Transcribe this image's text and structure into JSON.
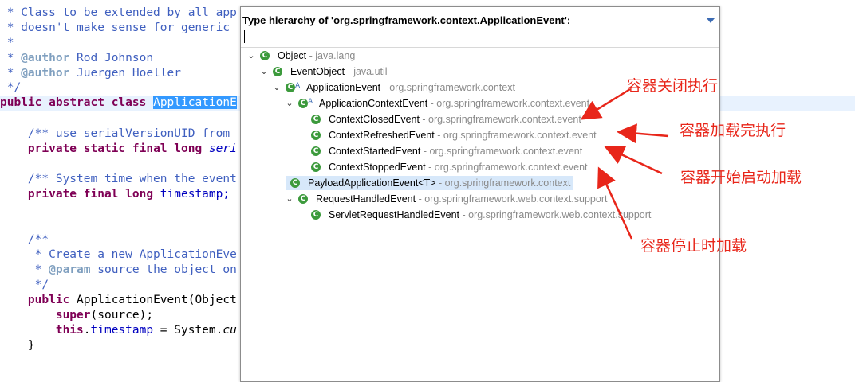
{
  "editor": {
    "lines": [
      " * Class to be extended by all app",
      " * doesn't make sense for generic",
      " *",
      " * @author Rod Johnson",
      " * @author Juergen Hoeller",
      " */",
      "public abstract class ApplicationE",
      "    /** use serialVersionUID from",
      "    private static final long seri",
      "    /** System time when the event",
      "    private final long timestamp;",
      "    /**",
      "     * Create a new ApplicationEve",
      "     * @param source the object on",
      "     */",
      "    public ApplicationEvent(Object",
      "        super(source);",
      "        this.timestamp = System.cu",
      "    }"
    ],
    "tokens": {
      "star": " *",
      "class_prefix": " * Class to be extended by all app",
      "doesnt": " * doesn't make sense for generic",
      "author": "@author",
      "rod": " Rod Johnson",
      "juergen": " Juergen Hoeller",
      "end_comment": " */",
      "public": "public",
      "abstract": "abstract",
      "class": "class",
      "selected_name": "ApplicationE",
      "c1": "    /** use serialVersionUID from",
      "private": "private",
      "static": "static",
      "final": "final",
      "long": "long",
      "seri": "seri",
      "c2": "    /** System time when the event",
      "timestamp_decl": " timestamp;",
      "c3": "    /**",
      "c4": "     * Create a new ApplicationEve",
      "param": "@param",
      "c5": " source the object on",
      "c6": "     */",
      "ctor": " ApplicationEvent(Object",
      "super": "super",
      "super_rest": "(source);",
      "this": "this",
      "dot": ".",
      "timestamp_fld": "timestamp",
      "assign": " = System.",
      "cu": "cu",
      "close": "    }"
    }
  },
  "popup": {
    "title": "Type hierarchy of 'org.springframework.context.ApplicationEvent':",
    "view_menu_icon": "chevron-down-icon",
    "tree": [
      {
        "name": "Object",
        "pkg": " - java.lang",
        "expanded": true
      },
      {
        "name": "EventObject",
        "pkg": " - java.util",
        "expanded": true
      },
      {
        "name": "ApplicationEvent",
        "pkg": " - org.springframework.context",
        "expanded": true,
        "abstract": "A"
      },
      {
        "name": "ApplicationContextEvent",
        "pkg": " - org.springframework.context.event",
        "expanded": true,
        "abstract": "A"
      },
      {
        "name": "ContextClosedEvent",
        "pkg": " - org.springframework.context.event"
      },
      {
        "name": "ContextRefreshedEvent",
        "pkg": " - org.springframework.context.event"
      },
      {
        "name": "ContextStartedEvent",
        "pkg": " - org.springframework.context.event"
      },
      {
        "name": "ContextStoppedEvent",
        "pkg": " - org.springframework.context.event"
      },
      {
        "name": "PayloadApplicationEvent<T>",
        "pkg": " - org.springframework.context",
        "selected": true
      },
      {
        "name": "RequestHandledEvent",
        "pkg": " - org.springframework.web.context.support",
        "expanded": true
      },
      {
        "name": "ServletRequestHandledEvent",
        "pkg": " - org.springframework.web.context.support"
      }
    ],
    "class_icon_glyph": "C",
    "expanded_glyph": "⌄"
  },
  "annotations": [
    "容器关闭执行",
    "容器加载完执行",
    "容器开始启动加载",
    "容器停止时加载"
  ],
  "colors": {
    "annotation": "#e8261a",
    "class_icon": "#3c9a3c",
    "selection": "#d7e8fa",
    "keyword": "#7f0055",
    "comment": "#3f5fbf"
  }
}
